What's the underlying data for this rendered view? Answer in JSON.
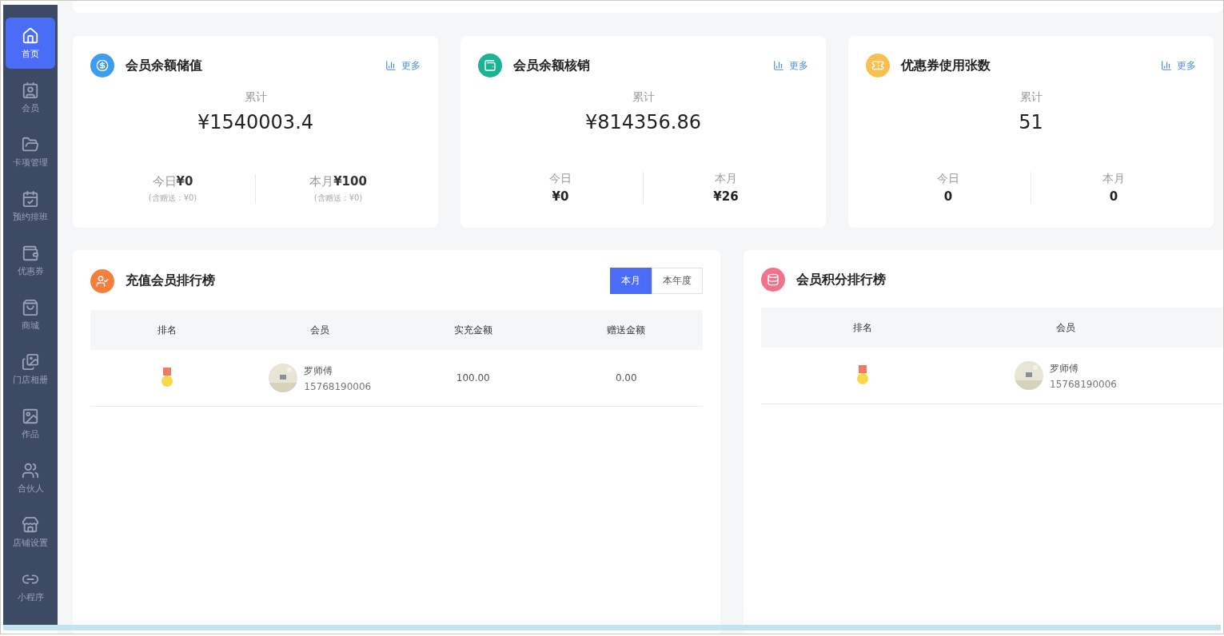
{
  "sidebar": {
    "items": [
      {
        "label": "首页",
        "selected": true
      },
      {
        "label": "会员",
        "selected": false
      },
      {
        "label": "卡项管理",
        "selected": false
      },
      {
        "label": "预约排班",
        "selected": false
      },
      {
        "label": "优惠券",
        "selected": false
      },
      {
        "label": "商城",
        "selected": false
      },
      {
        "label": "门店相册",
        "selected": false
      },
      {
        "label": "作品",
        "selected": false
      },
      {
        "label": "合伙人",
        "selected": false
      },
      {
        "label": "店铺设置",
        "selected": false
      },
      {
        "label": "小程序",
        "selected": false
      }
    ]
  },
  "stat_cards": [
    {
      "title": "会员余额储值",
      "color": "#3d9bf0",
      "more": "更多",
      "total_label": "累计",
      "total": "¥1540003.4",
      "kind": "inline",
      "today": {
        "label": "今日",
        "value": "¥0",
        "note": "(含赠送：¥0)"
      },
      "month": {
        "label": "本月",
        "value": "¥100",
        "note": "(含赠送：¥0)"
      }
    },
    {
      "title": "会员余额核销",
      "color": "#1bb394",
      "more": "更多",
      "total_label": "累计",
      "total": "¥814356.86",
      "kind": "stacked",
      "today": {
        "label": "今日",
        "value": "¥0"
      },
      "month": {
        "label": "本月",
        "value": "¥26"
      }
    },
    {
      "title": "优惠券使用张数",
      "color": "#f7c04f",
      "more": "更多",
      "total_label": "累计",
      "total": "51",
      "kind": "stacked",
      "today": {
        "label": "今日",
        "value": "0"
      },
      "month": {
        "label": "本月",
        "value": "0"
      }
    }
  ],
  "rankings": [
    {
      "title": "充值会员排行榜",
      "color": "#f47e3c",
      "tabs": [
        {
          "label": "本月",
          "selected": true
        },
        {
          "label": "本年度",
          "selected": false
        }
      ],
      "columns": [
        "排名",
        "会员",
        "实充金额",
        "赠送金额"
      ],
      "rows": [
        {
          "cells": [
            {
              "kind": "medal"
            },
            {
              "kind": "member",
              "name": "罗师傅",
              "phone": "15768190006"
            },
            {
              "kind": "text",
              "text": "100.00"
            },
            {
              "kind": "text",
              "text": "0.00"
            }
          ]
        }
      ]
    },
    {
      "title": "会员积分排行榜",
      "color": "#f0738b",
      "columns": [
        "排名",
        "会员"
      ],
      "rows": [
        {
          "cells": [
            {
              "kind": "medal"
            },
            {
              "kind": "member",
              "name": "罗师傅",
              "phone": "15768190006"
            }
          ]
        }
      ]
    }
  ]
}
